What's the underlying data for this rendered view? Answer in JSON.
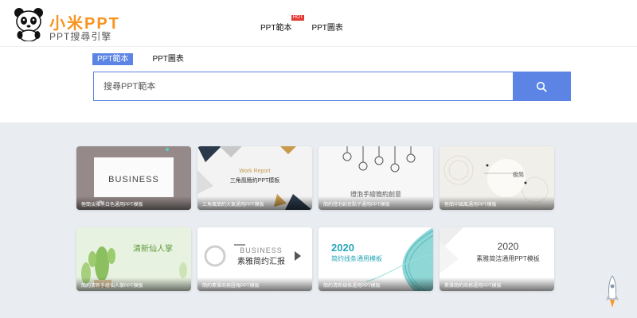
{
  "brand": {
    "title": "小米PPT",
    "subtitle": "PPT搜尋引擎",
    "logo_icon": "panda-icon"
  },
  "nav": [
    {
      "label": "PPT範本",
      "badge": "HOT"
    },
    {
      "label": "PPT圖表"
    }
  ],
  "search": {
    "tabs": [
      {
        "label": "PPT範本",
        "active": true
      },
      {
        "label": "PPT圖表",
        "active": false
      }
    ],
    "placeholder": "搜尋PPT範本",
    "button_icon": "search-icon"
  },
  "templates": [
    {
      "caption": "極簡淡雅黑白色通用PPT模板",
      "text": "BUSINESS"
    },
    {
      "caption": "三角風簡約大氣通用PPT模板",
      "text": "Work Report",
      "text2": "三角風簡約PPT模板"
    },
    {
      "caption": "簡約燈泡創意點子通用PPT模板",
      "text": "燈泡手繪簡約創意"
    },
    {
      "caption": "極簡中國風通用PPT模板",
      "text": "极简"
    },
    {
      "caption": "簡約清新手繪仙人掌PPT模板",
      "text": "清新仙人掌"
    },
    {
      "caption": "簡約素雅商務匯報PPT模板",
      "text": "BUSINESS",
      "text2": "素雅简约汇报"
    },
    {
      "caption": "簡約清新線條通用PPT模板",
      "text": "2020",
      "text2": "简约线条通用模板"
    },
    {
      "caption": "素雅簡約商務通用PPT模板",
      "text": "2020",
      "text2": "素雅简洁通用PPT模板"
    }
  ],
  "colors": {
    "accent": "#5b84e5",
    "brand": "#f7931e",
    "badge": "#e53935"
  },
  "back_to_top_icon": "rocket-icon"
}
